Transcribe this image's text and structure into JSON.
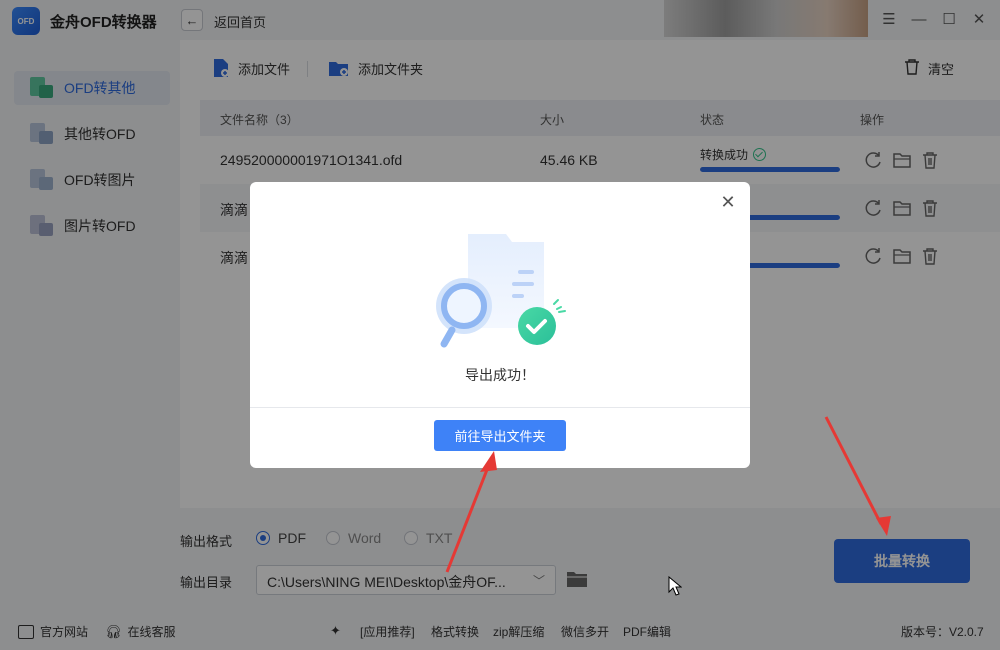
{
  "app": {
    "title": "金舟OFD转换器",
    "logo_text": "OFD"
  },
  "header": {
    "back_label": "返回首页"
  },
  "sidebar": {
    "items": [
      {
        "label": "OFD转其他",
        "active": true
      },
      {
        "label": "其他转OFD",
        "active": false
      },
      {
        "label": "OFD转图片",
        "active": false
      },
      {
        "label": "图片转OFD",
        "active": false
      }
    ]
  },
  "toolbar": {
    "add_file": "添加文件",
    "add_folder": "添加文件夹",
    "clear": "清空"
  },
  "table": {
    "headers": {
      "name": "文件名称（3）",
      "size": "大小",
      "status": "状态",
      "ops": "操作"
    },
    "rows": [
      {
        "name": "249520000001971O1341.ofd",
        "size": "45.46 KB",
        "status": "转换成功",
        "progress": 1.0
      },
      {
        "name": "滴滴",
        "size": "",
        "status": "",
        "progress": 1.0
      },
      {
        "name": "滴滴",
        "size": "",
        "status": "",
        "progress": 1.0
      }
    ]
  },
  "output": {
    "format_label": "输出格式",
    "formats": [
      {
        "label": "PDF",
        "checked": true
      },
      {
        "label": "Word",
        "checked": false
      },
      {
        "label": "TXT",
        "checked": false
      }
    ],
    "dir_label": "输出目录",
    "dir_value": "C:\\Users\\NING MEI\\Desktop\\金舟OF..."
  },
  "batch_button": "批量转换",
  "footer": {
    "website": "官方网站",
    "support": "在线客服",
    "links": [
      "[应用推荐]",
      "格式转换",
      "zip解压缩",
      "微信多开",
      "PDF编辑"
    ],
    "version": "版本号：V2.0.7"
  },
  "modal": {
    "message": "导出成功！",
    "open_folder_button": "前往导出文件夹"
  },
  "colors": {
    "accent": "#2f6bde",
    "success": "#34c48c",
    "modal_button": "#3e82f7",
    "annotation": "#e53935"
  }
}
